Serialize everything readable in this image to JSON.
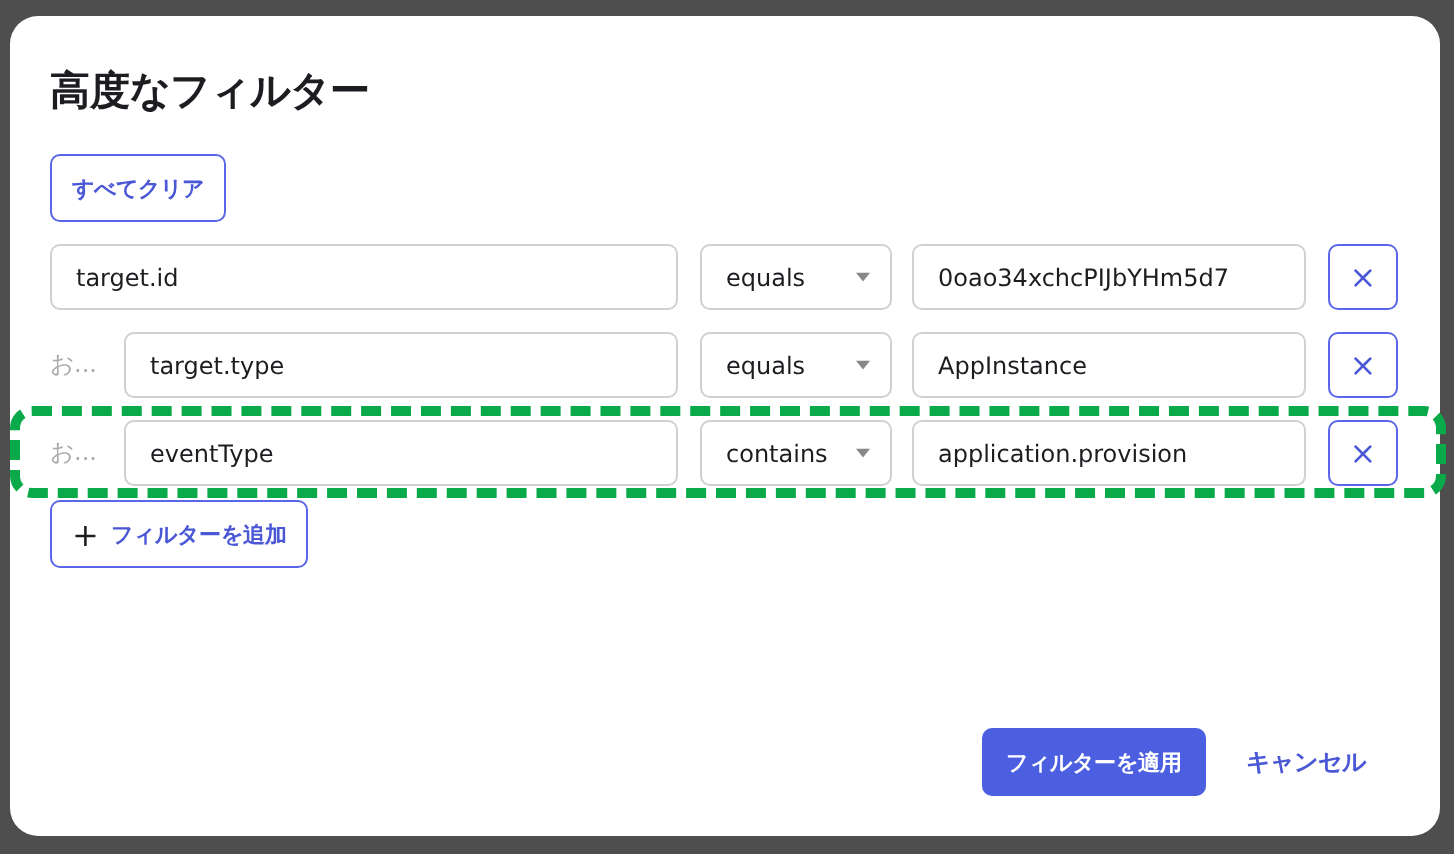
{
  "dialog": {
    "title": "高度なフィルター",
    "clear_button": "すべてクリア",
    "filters": [
      {
        "field": "target.id",
        "operator": "equals",
        "value": "0oao34xchcPIJbYHm5d7",
        "remove": "×"
      },
      {
        "connector": "お...",
        "field": "target.type",
        "operator": "equals",
        "value": "AppInstance",
        "remove": "×"
      },
      {
        "connector": "お...",
        "field": "eventType",
        "operator": "contains",
        "value": "application.provision",
        "remove": "×",
        "highlighted": true
      }
    ],
    "add_button": {
      "icon": "+",
      "label": "フィルターを追加"
    },
    "apply_button": "フィルターを適用",
    "cancel_button": "キャンセル"
  }
}
